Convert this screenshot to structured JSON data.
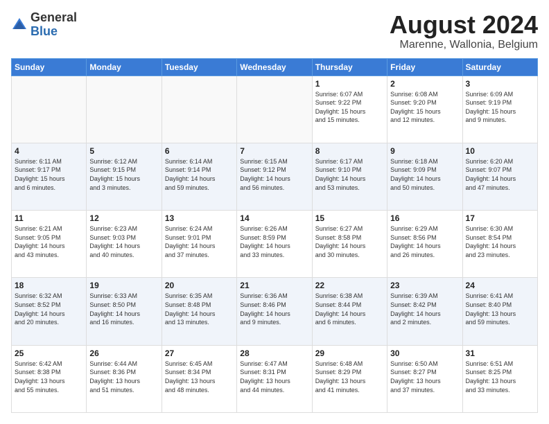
{
  "header": {
    "logo_general": "General",
    "logo_blue": "Blue",
    "month_year": "August 2024",
    "location": "Marenne, Wallonia, Belgium"
  },
  "days_of_week": [
    "Sunday",
    "Monday",
    "Tuesday",
    "Wednesday",
    "Thursday",
    "Friday",
    "Saturday"
  ],
  "weeks": [
    [
      {
        "day": "",
        "info": ""
      },
      {
        "day": "",
        "info": ""
      },
      {
        "day": "",
        "info": ""
      },
      {
        "day": "",
        "info": ""
      },
      {
        "day": "1",
        "info": "Sunrise: 6:07 AM\nSunset: 9:22 PM\nDaylight: 15 hours\nand 15 minutes."
      },
      {
        "day": "2",
        "info": "Sunrise: 6:08 AM\nSunset: 9:20 PM\nDaylight: 15 hours\nand 12 minutes."
      },
      {
        "day": "3",
        "info": "Sunrise: 6:09 AM\nSunset: 9:19 PM\nDaylight: 15 hours\nand 9 minutes."
      }
    ],
    [
      {
        "day": "4",
        "info": "Sunrise: 6:11 AM\nSunset: 9:17 PM\nDaylight: 15 hours\nand 6 minutes."
      },
      {
        "day": "5",
        "info": "Sunrise: 6:12 AM\nSunset: 9:15 PM\nDaylight: 15 hours\nand 3 minutes."
      },
      {
        "day": "6",
        "info": "Sunrise: 6:14 AM\nSunset: 9:14 PM\nDaylight: 14 hours\nand 59 minutes."
      },
      {
        "day": "7",
        "info": "Sunrise: 6:15 AM\nSunset: 9:12 PM\nDaylight: 14 hours\nand 56 minutes."
      },
      {
        "day": "8",
        "info": "Sunrise: 6:17 AM\nSunset: 9:10 PM\nDaylight: 14 hours\nand 53 minutes."
      },
      {
        "day": "9",
        "info": "Sunrise: 6:18 AM\nSunset: 9:09 PM\nDaylight: 14 hours\nand 50 minutes."
      },
      {
        "day": "10",
        "info": "Sunrise: 6:20 AM\nSunset: 9:07 PM\nDaylight: 14 hours\nand 47 minutes."
      }
    ],
    [
      {
        "day": "11",
        "info": "Sunrise: 6:21 AM\nSunset: 9:05 PM\nDaylight: 14 hours\nand 43 minutes."
      },
      {
        "day": "12",
        "info": "Sunrise: 6:23 AM\nSunset: 9:03 PM\nDaylight: 14 hours\nand 40 minutes."
      },
      {
        "day": "13",
        "info": "Sunrise: 6:24 AM\nSunset: 9:01 PM\nDaylight: 14 hours\nand 37 minutes."
      },
      {
        "day": "14",
        "info": "Sunrise: 6:26 AM\nSunset: 8:59 PM\nDaylight: 14 hours\nand 33 minutes."
      },
      {
        "day": "15",
        "info": "Sunrise: 6:27 AM\nSunset: 8:58 PM\nDaylight: 14 hours\nand 30 minutes."
      },
      {
        "day": "16",
        "info": "Sunrise: 6:29 AM\nSunset: 8:56 PM\nDaylight: 14 hours\nand 26 minutes."
      },
      {
        "day": "17",
        "info": "Sunrise: 6:30 AM\nSunset: 8:54 PM\nDaylight: 14 hours\nand 23 minutes."
      }
    ],
    [
      {
        "day": "18",
        "info": "Sunrise: 6:32 AM\nSunset: 8:52 PM\nDaylight: 14 hours\nand 20 minutes."
      },
      {
        "day": "19",
        "info": "Sunrise: 6:33 AM\nSunset: 8:50 PM\nDaylight: 14 hours\nand 16 minutes."
      },
      {
        "day": "20",
        "info": "Sunrise: 6:35 AM\nSunset: 8:48 PM\nDaylight: 14 hours\nand 13 minutes."
      },
      {
        "day": "21",
        "info": "Sunrise: 6:36 AM\nSunset: 8:46 PM\nDaylight: 14 hours\nand 9 minutes."
      },
      {
        "day": "22",
        "info": "Sunrise: 6:38 AM\nSunset: 8:44 PM\nDaylight: 14 hours\nand 6 minutes."
      },
      {
        "day": "23",
        "info": "Sunrise: 6:39 AM\nSunset: 8:42 PM\nDaylight: 14 hours\nand 2 minutes."
      },
      {
        "day": "24",
        "info": "Sunrise: 6:41 AM\nSunset: 8:40 PM\nDaylight: 13 hours\nand 59 minutes."
      }
    ],
    [
      {
        "day": "25",
        "info": "Sunrise: 6:42 AM\nSunset: 8:38 PM\nDaylight: 13 hours\nand 55 minutes."
      },
      {
        "day": "26",
        "info": "Sunrise: 6:44 AM\nSunset: 8:36 PM\nDaylight: 13 hours\nand 51 minutes."
      },
      {
        "day": "27",
        "info": "Sunrise: 6:45 AM\nSunset: 8:34 PM\nDaylight: 13 hours\nand 48 minutes."
      },
      {
        "day": "28",
        "info": "Sunrise: 6:47 AM\nSunset: 8:31 PM\nDaylight: 13 hours\nand 44 minutes."
      },
      {
        "day": "29",
        "info": "Sunrise: 6:48 AM\nSunset: 8:29 PM\nDaylight: 13 hours\nand 41 minutes."
      },
      {
        "day": "30",
        "info": "Sunrise: 6:50 AM\nSunset: 8:27 PM\nDaylight: 13 hours\nand 37 minutes."
      },
      {
        "day": "31",
        "info": "Sunrise: 6:51 AM\nSunset: 8:25 PM\nDaylight: 13 hours\nand 33 minutes."
      }
    ]
  ]
}
